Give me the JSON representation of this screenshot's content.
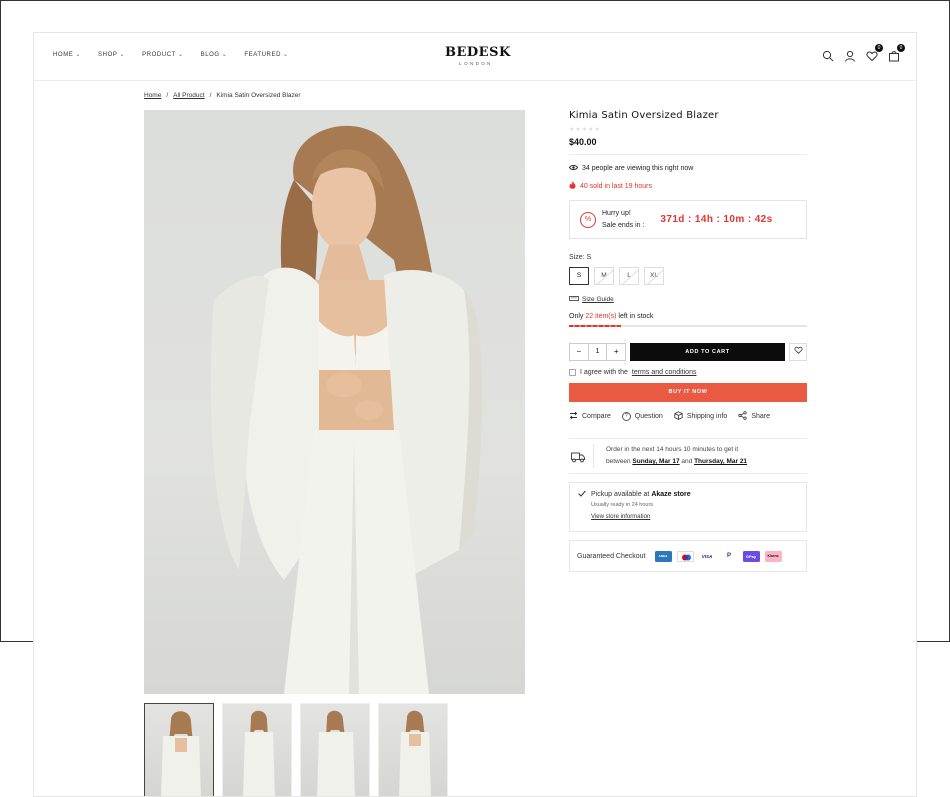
{
  "header": {
    "nav": [
      {
        "label": "HOME"
      },
      {
        "label": "SHOP"
      },
      {
        "label": "PRODUCT"
      },
      {
        "label": "BLOG"
      },
      {
        "label": "FEATURED"
      }
    ],
    "logo_main": "BEDESK",
    "logo_sub": "LONDON",
    "wishlist_count": "0",
    "cart_count": "0",
    "icons": [
      "search-icon",
      "user-icon",
      "heart-icon",
      "bag-icon"
    ]
  },
  "breadcrumb": {
    "home": "Home",
    "sep1": "/",
    "all": "All Product",
    "sep2": "/",
    "current": "Kimia Satin Oversized Blazer"
  },
  "product": {
    "title": "Kimia Satin Oversized Blazer",
    "stars": "★★★★★",
    "price": "$40.00",
    "viewing": "34 people are viewing this right now",
    "sold": "40 sold in last 19 hours",
    "hurry1": "Hurry up!",
    "hurry2": "Sale ends in :",
    "countdown": "371d : 14h : 10m : 42s",
    "size_label": "Size: S",
    "sizes": [
      "S",
      "M",
      "L",
      "XL"
    ],
    "size_guide": "Size Guide",
    "stock_prefix": "Only ",
    "stock_count": "22 item(s)",
    "stock_suffix": " left in stock",
    "stock_level": 0.22,
    "qty_minus": "−",
    "qty_value": "1",
    "qty_plus": "+",
    "add_to_cart": "ADD TO CART",
    "agree_prefix": "I agree with the ",
    "agree_link": "terms and conditions",
    "buy_now": "BUY IT NOW",
    "actions": [
      "Compare",
      "Question",
      "Shipping info",
      "Share"
    ],
    "delivery_line1": "Order in the next 14 hours 10 minutes to get it",
    "delivery_between": "between ",
    "delivery_date1": "Sunday, Mar 17",
    "delivery_and": " and ",
    "delivery_date2": "Thursday, Mar 21",
    "pickup_prefix": "Pickup available at ",
    "pickup_store": "Akaze store",
    "pickup_sub": "Usually ready in 24 hours",
    "pickup_link": "View store information",
    "guaranteed": "Guaranteed Checkout",
    "payments": [
      {
        "label": "AMEX",
        "color": "#2e77bb"
      },
      {
        "label": "MC",
        "color": "#ffffff"
      },
      {
        "label": "VISA",
        "color": "#ffffff"
      },
      {
        "label": "P",
        "color": "#ffffff"
      },
      {
        "label": "GPay",
        "color": "#6b4ce6"
      },
      {
        "label": "Klarna",
        "color": "#ffb3c7"
      }
    ]
  },
  "colors": {
    "accent_red": "#e3342f",
    "buy_now": "#ea5a43",
    "dark": "#0c0c0c"
  }
}
